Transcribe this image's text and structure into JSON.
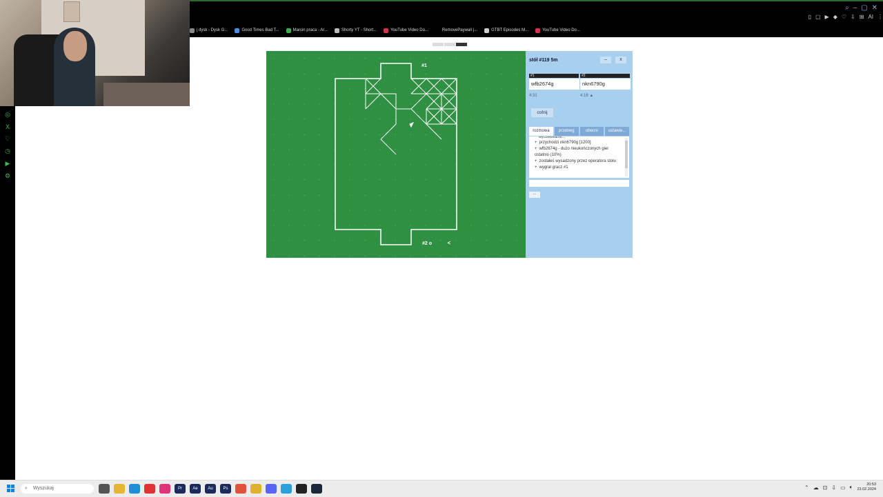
{
  "browser": {
    "bookmarks": [
      {
        "label": "j dysk - Dysk G...",
        "color": "#888888"
      },
      {
        "label": "Good Times Bad T...",
        "color": "#4a8de0"
      },
      {
        "label": "Marcin praca - Ar...",
        "color": "#3daf50"
      },
      {
        "label": "Shorty YT - Short...",
        "color": "#bbbbbb"
      },
      {
        "label": "YouTube Video Do...",
        "color": "#d6304a"
      },
      {
        "label": "RemovePaywall |...",
        "color": "#000000"
      },
      {
        "label": "GTBT Episodes M...",
        "color": "#cccccc"
      },
      {
        "label": "YouTube Video Do...",
        "color": "#d6304a"
      }
    ]
  },
  "game": {
    "board_color": "#2f8f43",
    "line_color": "#ffffff",
    "player1_marker": "#1",
    "player2_marker": "#2 o",
    "back_arrow": "<"
  },
  "panel": {
    "title": "stół #119  5m",
    "minimize_label": "–",
    "close_label": "x",
    "players": [
      {
        "tag": "#1",
        "name": "wfb2674g",
        "time": "4:31"
      },
      {
        "tag": "#2",
        "name": "nkn6790g",
        "time": "4:16 ▲"
      }
    ],
    "undo_label": "cofnij",
    "tabs": [
      "rozmowa",
      "przebieg",
      "obecni",
      "ustawie..."
    ],
    "chat_cutoff": "wyczekiwanie...",
    "chat": [
      "przychodzi nkn6790g [1200]",
      "wfb2674g - dużo nieukończonych gier ostatnio (10%)",
      "zostałeś wysadzony przez operatora stołu",
      "wygrał gracz #1"
    ],
    "more_label": "..."
  },
  "taskbar": {
    "search_placeholder": "Wyszukaj",
    "time": "20:53",
    "date": "23.02.2024"
  }
}
